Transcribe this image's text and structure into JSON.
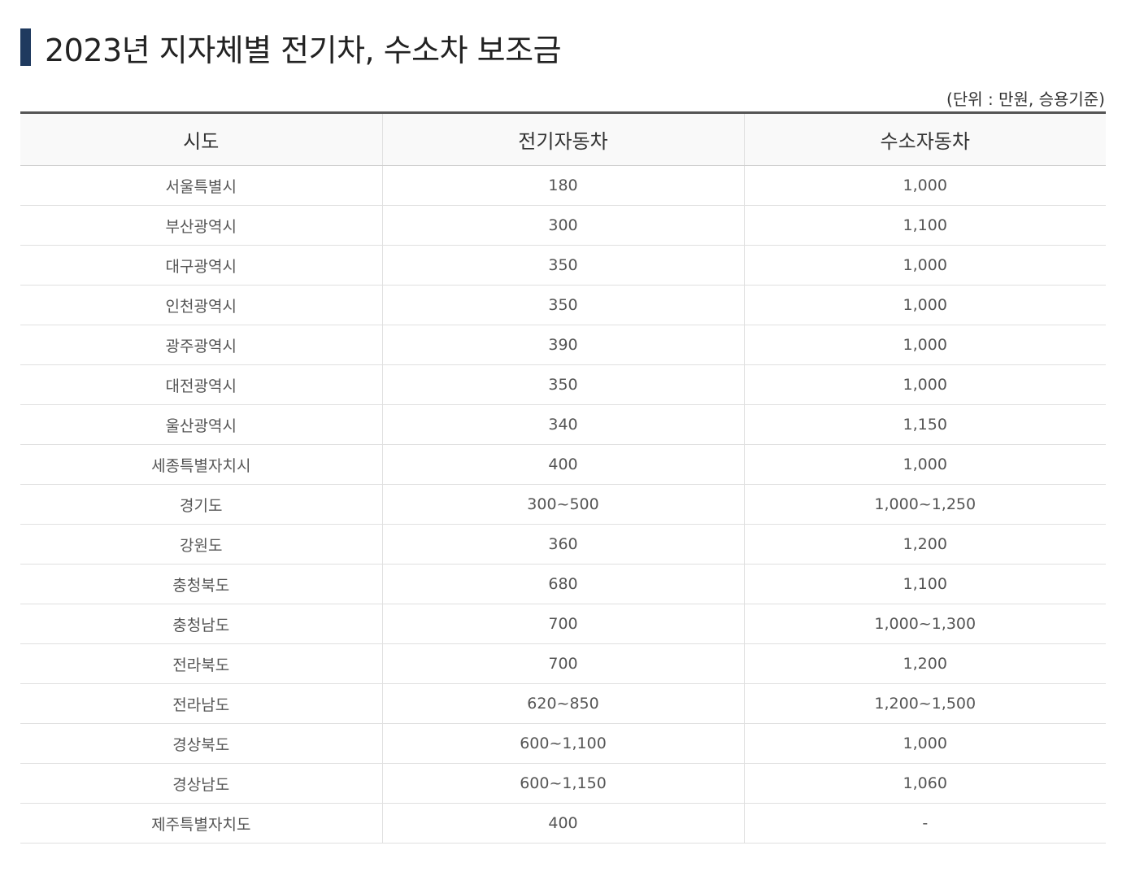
{
  "title": "2023년 지자체별 전기차, 수소차 보조금",
  "unit_note": "(단위 : 만원, 승용기준)",
  "table": {
    "headers": [
      "시도",
      "전기자동차",
      "수소자동차"
    ],
    "rows": [
      [
        "서울특별시",
        "180",
        "1,000"
      ],
      [
        "부산광역시",
        "300",
        "1,100"
      ],
      [
        "대구광역시",
        "350",
        "1,000"
      ],
      [
        "인천광역시",
        "350",
        "1,000"
      ],
      [
        "광주광역시",
        "390",
        "1,000"
      ],
      [
        "대전광역시",
        "350",
        "1,000"
      ],
      [
        "울산광역시",
        "340",
        "1,150"
      ],
      [
        "세종특별자치시",
        "400",
        "1,000"
      ],
      [
        "경기도",
        "300~500",
        "1,000~1,250"
      ],
      [
        "강원도",
        "360",
        "1,200"
      ],
      [
        "충청북도",
        "680",
        "1,100"
      ],
      [
        "충청남도",
        "700",
        "1,000~1,300"
      ],
      [
        "전라북도",
        "700",
        "1,200"
      ],
      [
        "전라남도",
        "620~850",
        "1,200~1,500"
      ],
      [
        "경상북도",
        "600~1,100",
        "1,000"
      ],
      [
        "경상남도",
        "600~1,150",
        "1,060"
      ],
      [
        "제주특별자치도",
        "400",
        "-"
      ]
    ]
  },
  "colors": {
    "title_accent": "#1f3a5f",
    "table_top_border": "#555555",
    "header_background": "#f9f9f9"
  }
}
